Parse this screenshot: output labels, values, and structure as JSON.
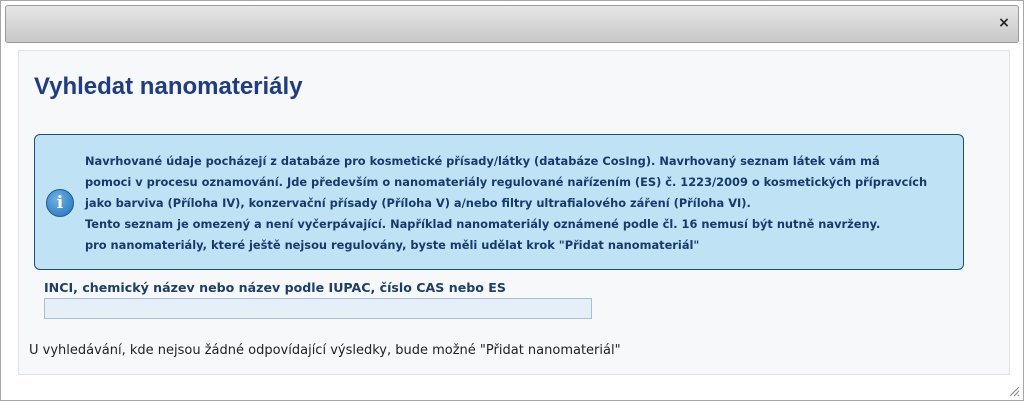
{
  "dialog": {
    "close_symbol": "×",
    "close_icon": "close-icon"
  },
  "main": {
    "title": "Vyhledat nanomateriály",
    "info": {
      "icon": "info-icon",
      "lines": [
        "Navrhované údaje pocházejí z databáze pro kosmetické přísady/látky (databáze CosIng). Navrhovaný seznam látek vám má",
        "pomoci v procesu oznamování. Jde především o nanomateriály regulované nařízením (ES) č. 1223/2009 o kosmetických přípravcích",
        "jako barviva (Příloha IV), konzervační přísady (Příloha V) a/nebo filtry ultrafialového záření (Příloha VI).",
        "Tento seznam je omezený a není vyčerpávající. Například nanomateriály oznámené podle čl. 16 nemusí být nutně navrženy.",
        "pro nanomateriály, které ještě nejsou regulovány, byste měli udělat krok \"Přidat nanomateriál\""
      ]
    },
    "search": {
      "label": "INCI, chemický název nebo název podle IUPAC, číslo CAS nebo ES",
      "value": "",
      "placeholder": ""
    },
    "hint": "U vyhledávání, kde nejsou žádné odpovídající výsledky, bude možné \"Přidat nanomateriál\""
  },
  "colors": {
    "title": "#1f3c88",
    "info_bg": "#bfe3f5",
    "info_border": "#1e4f7a",
    "info_text": "#173a6d",
    "input_bg": "#e6eef7"
  }
}
